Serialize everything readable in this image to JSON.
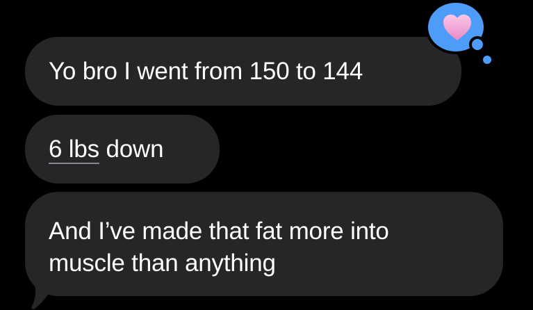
{
  "messages": [
    {
      "segments": [
        {
          "text": "Yo bro I went from 150 to 144"
        }
      ]
    },
    {
      "segments": [
        {
          "text": "6 lbs",
          "underlined": true
        },
        {
          "text": " down"
        }
      ]
    },
    {
      "segments": [
        {
          "text": "And I’ve made that fat more into"
        },
        {
          "text": "muscle than anything"
        }
      ]
    }
  ],
  "tapback": {
    "icon": "heart-icon",
    "heart_color": "#f4a9d6",
    "bubble_color": "#4d9cf7"
  },
  "colors": {
    "background": "#000000",
    "bubble": "#262629",
    "text": "#ffffff"
  }
}
